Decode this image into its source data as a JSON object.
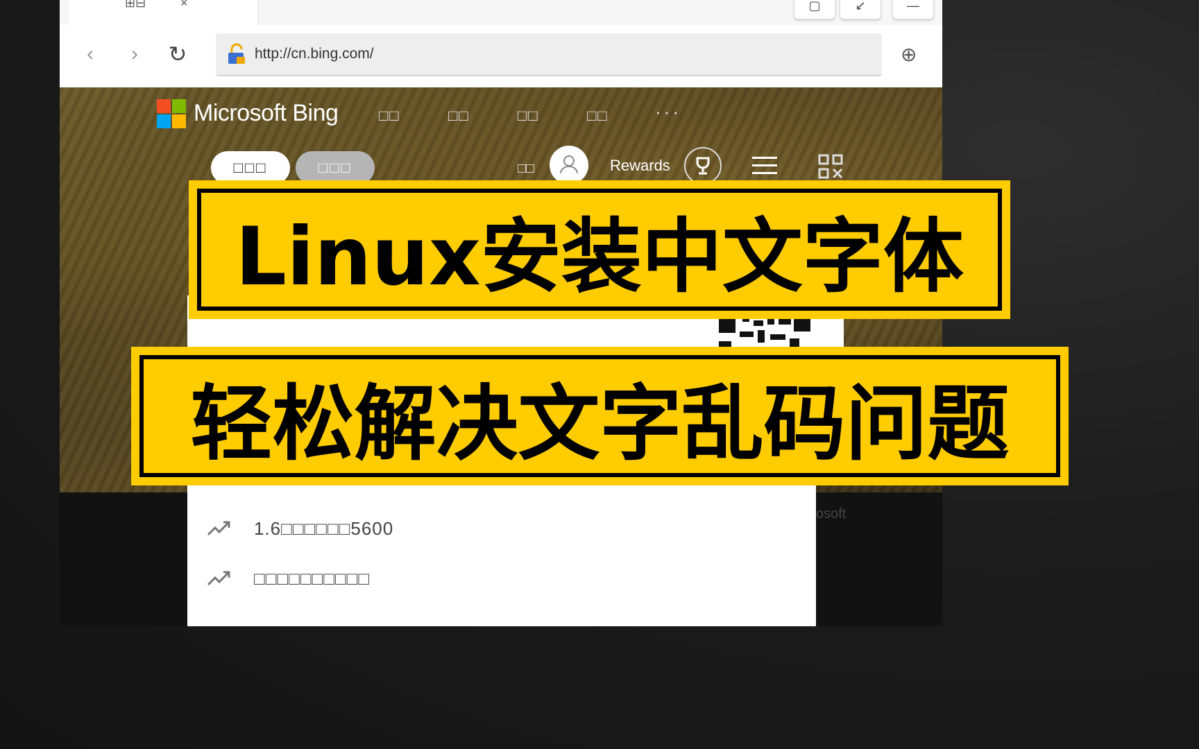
{
  "browser": {
    "url": "http://cn.bing.com/",
    "tab_icons": "⊞⊟",
    "tab_close": "×"
  },
  "bing": {
    "brand": "Microsoft Bing",
    "nav_items": [
      "□□",
      "□□",
      "□□",
      "□□"
    ],
    "more": "···",
    "search_tabs": [
      "□□□",
      "□□□"
    ],
    "lang": "□□",
    "rewards": "Rewards"
  },
  "suggestions": [
    "□□□□□□□□□□□",
    "□□□□□□□□□□",
    "1.6□□□□□□5600",
    "□□□□□□□□□□"
  ],
  "footer_fragment": "osoft",
  "banners": {
    "title": "Linux安装中文字体",
    "subtitle": "轻松解决文字乱码问题"
  },
  "colors": {
    "banner_yellow": "#ffcc00",
    "banner_border": "#000000",
    "background": "#1c1c1c"
  }
}
